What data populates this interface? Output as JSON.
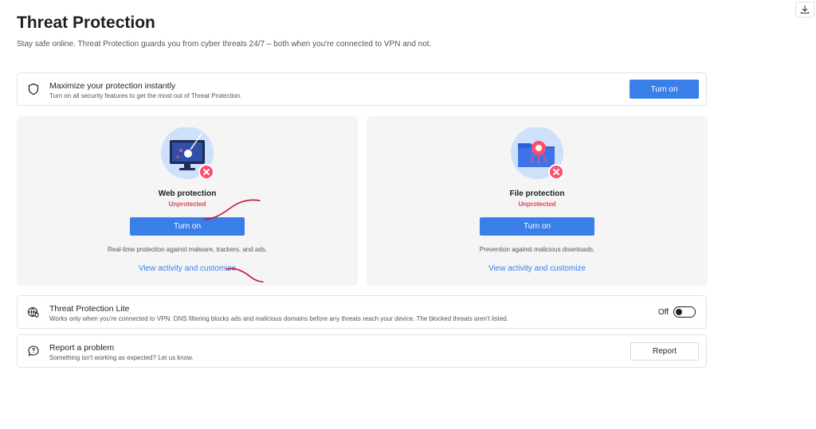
{
  "header": {
    "title": "Threat Protection",
    "subtitle": "Stay safe online. Threat Protection guards you from cyber threats 24/7 – both when you're connected to VPN and not."
  },
  "maximize": {
    "title": "Maximize your protection instantly",
    "description": "Turn on all security features to get the most out of Threat Protection.",
    "button_label": "Turn on",
    "icon": "shield-icon"
  },
  "web_protection": {
    "title": "Web protection",
    "status": "Unprotected",
    "button_label": "Turn on",
    "description": "Real-time protection against malware, trackers, and ads.",
    "link": "View activity and customize"
  },
  "file_protection": {
    "title": "File protection",
    "status": "Unprotected",
    "button_label": "Turn on",
    "description": "Prevention against malicious downloads.",
    "link": "View activity and customize"
  },
  "lite": {
    "title": "Threat Protection Lite",
    "description": "Works only when you're connected to VPN. DNS filtering blocks ads and malicious domains before any threats reach your device. The blocked threats aren't listed.",
    "toggle_label": "Off",
    "toggle_state": false,
    "icon": "globe-shield-icon"
  },
  "report": {
    "title": "Report a problem",
    "description": "Something isn't working as expected? Let us know.",
    "button_label": "Report",
    "icon": "chat-question-icon"
  },
  "colors": {
    "accent": "#3a7ee8",
    "danger": "#e0444f",
    "panel_bg": "#f5f5f6",
    "annotation": "#c8102e"
  }
}
